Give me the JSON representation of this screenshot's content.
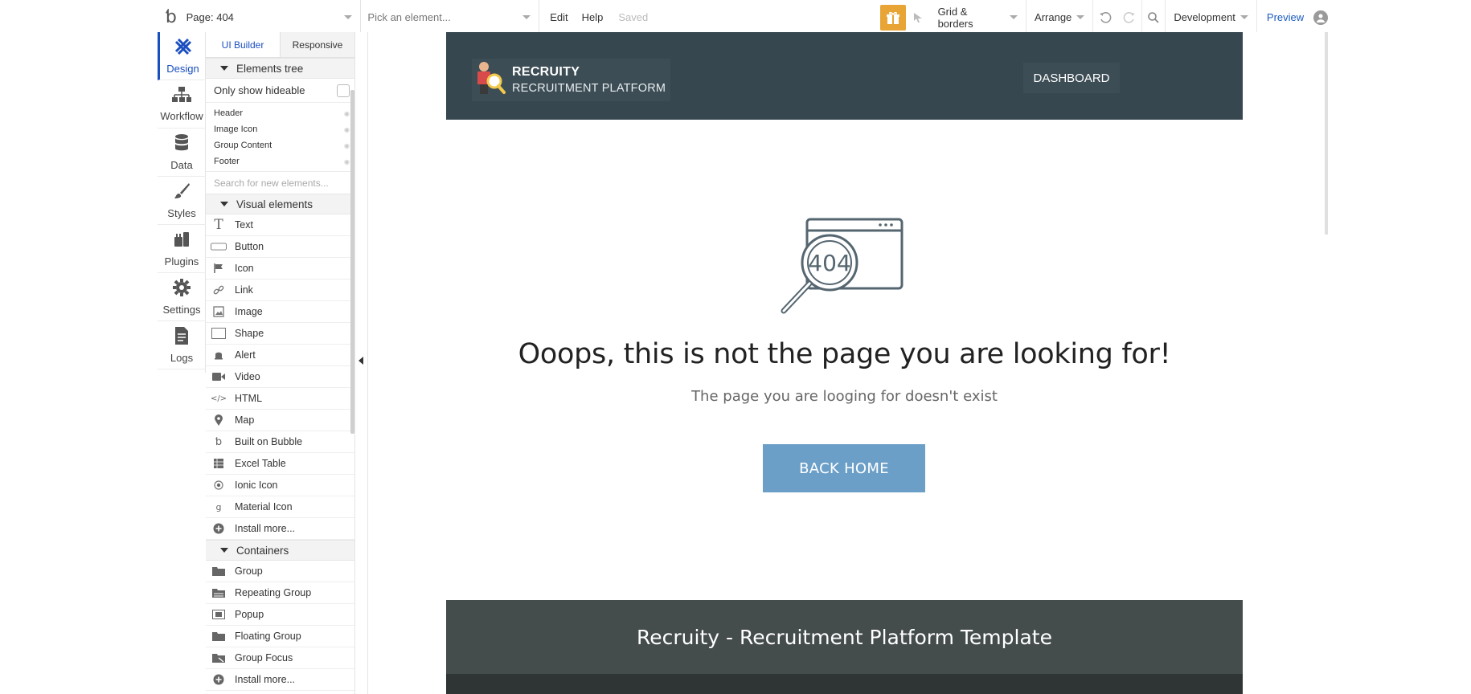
{
  "topbar": {
    "page_label": "Page: 404",
    "element_placeholder": "Pick an element...",
    "menu": [
      "Edit",
      "Help"
    ],
    "saved_status": "Saved",
    "grid_label": "Grid & borders",
    "arrange_label": "Arrange",
    "env_label": "Development",
    "preview_label": "Preview"
  },
  "rail": {
    "items": [
      {
        "label": "Design",
        "icon": "design-icon"
      },
      {
        "label": "Workflow",
        "icon": "workflow-icon"
      },
      {
        "label": "Data",
        "icon": "data-icon"
      },
      {
        "label": "Styles",
        "icon": "styles-icon"
      },
      {
        "label": "Plugins",
        "icon": "plugins-icon"
      },
      {
        "label": "Settings",
        "icon": "settings-icon"
      },
      {
        "label": "Logs",
        "icon": "logs-icon"
      }
    ]
  },
  "panel": {
    "tabs": [
      "UI Builder",
      "Responsive"
    ],
    "tree_title": "Elements tree",
    "only_hideable": "Only show hideable",
    "tree_items": [
      "Header",
      "Image Icon",
      "Group Content",
      "Footer"
    ],
    "search_placeholder": "Search for new elements...",
    "visual_title": "Visual elements",
    "visual_items": [
      {
        "label": "Text",
        "icon": "text-icon"
      },
      {
        "label": "Button",
        "icon": "button-icon"
      },
      {
        "label": "Icon",
        "icon": "flag-icon"
      },
      {
        "label": "Link",
        "icon": "link-icon"
      },
      {
        "label": "Image",
        "icon": "image-icon"
      },
      {
        "label": "Shape",
        "icon": "shape-icon"
      },
      {
        "label": "Alert",
        "icon": "alert-icon"
      },
      {
        "label": "Video",
        "icon": "video-icon"
      },
      {
        "label": "HTML",
        "icon": "html-icon"
      },
      {
        "label": "Map",
        "icon": "map-pin-icon"
      },
      {
        "label": "Built on Bubble",
        "icon": "bubble-icon"
      },
      {
        "label": "Excel Table",
        "icon": "table-icon"
      },
      {
        "label": "Ionic Icon",
        "icon": "ionic-icon"
      },
      {
        "label": "Material Icon",
        "icon": "material-icon"
      },
      {
        "label": "Install more...",
        "icon": "plus-circle-icon"
      }
    ],
    "containers_title": "Containers",
    "container_items": [
      {
        "label": "Group",
        "icon": "folder-icon"
      },
      {
        "label": "Repeating Group",
        "icon": "repeating-group-icon"
      },
      {
        "label": "Popup",
        "icon": "popup-icon"
      },
      {
        "label": "Floating Group",
        "icon": "floating-group-icon"
      },
      {
        "label": "Group Focus",
        "icon": "group-focus-icon"
      },
      {
        "label": "Install more...",
        "icon": "plus-circle-icon"
      }
    ]
  },
  "canvas": {
    "header": {
      "brand_title": "RECRUITY",
      "brand_sub": "RECRUITMENT PLATFORM",
      "dashboard_label": "DASHBOARD"
    },
    "error_code": "404",
    "headline": "Ooops, this is not the page you are looking for!",
    "subline": "The page you are looging for doesn't exist",
    "back_label": "BACK HOME",
    "footer_text": "Recruity - Recruitment Platform Template"
  },
  "colors": {
    "accent": "#1a4fc0",
    "header_bg": "#37474f",
    "button_bg": "#6b9fc8",
    "footer_bg": "#454c4c",
    "gift": "#e8a435"
  }
}
